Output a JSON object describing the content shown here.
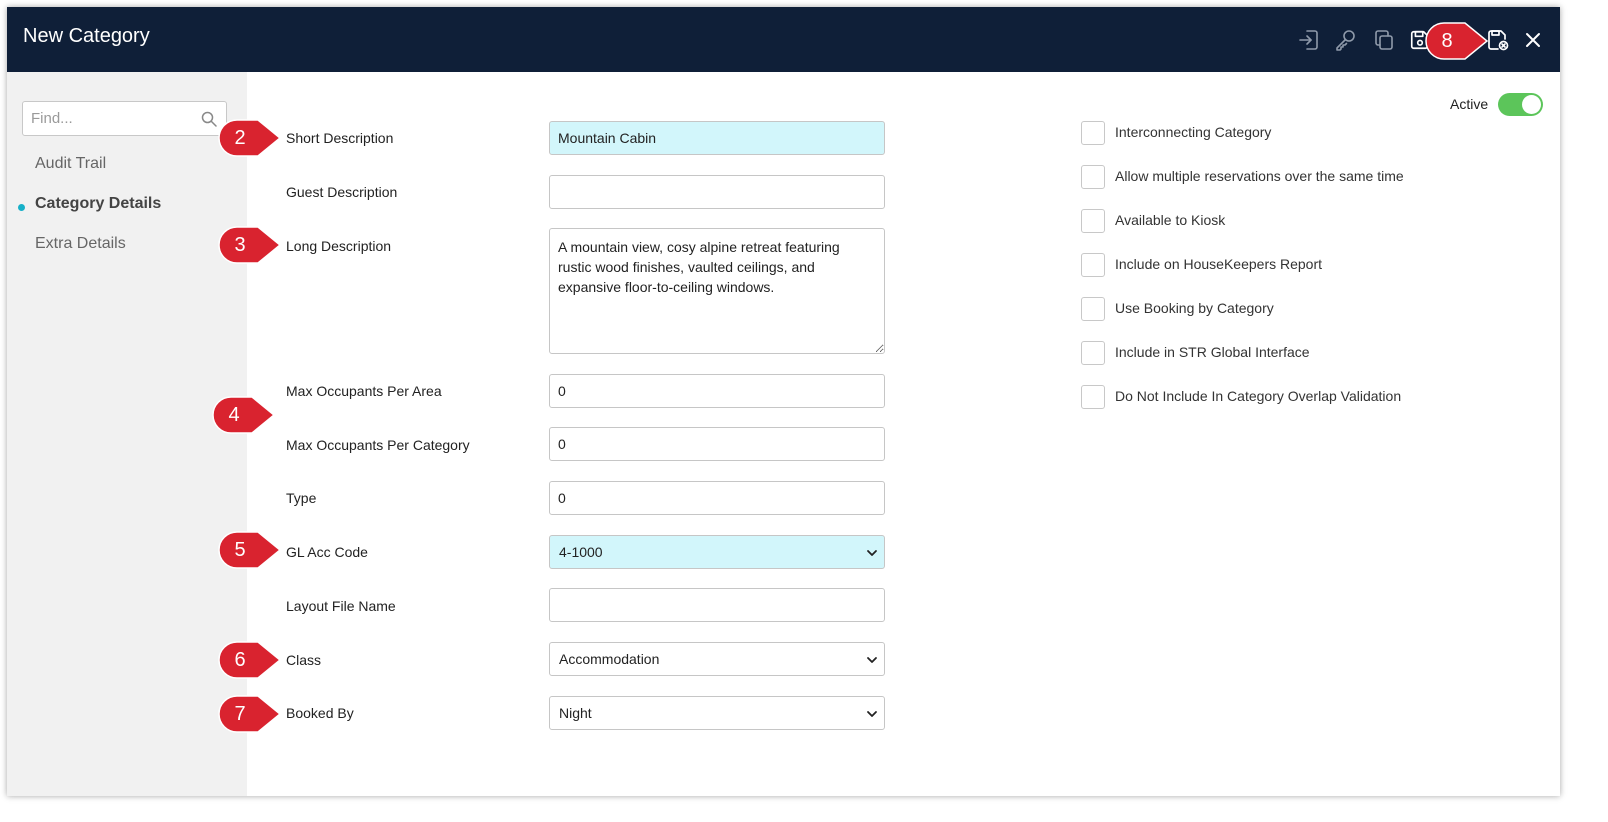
{
  "window": {
    "title": "New Category",
    "toolbar_icons": [
      "sign-in-icon",
      "key-icon",
      "copy-icon",
      "save-icon",
      "save-close-icon",
      "close-icon"
    ]
  },
  "sidebar": {
    "search_placeholder": "Find...",
    "items": [
      {
        "label": "Audit Trail",
        "active": false
      },
      {
        "label": "Category Details",
        "active": true
      },
      {
        "label": "Extra Details",
        "active": false
      }
    ]
  },
  "form": {
    "short_description": {
      "label": "Short Description",
      "value": "Mountain Cabin"
    },
    "guest_description": {
      "label": "Guest Description",
      "value": ""
    },
    "long_description": {
      "label": "Long Description",
      "value": "A mountain view, cosy alpine retreat featuring rustic wood finishes, vaulted ceilings, and expansive floor-to-ceiling windows."
    },
    "max_occ_area": {
      "label": "Max Occupants Per Area",
      "value": "0"
    },
    "max_occ_category": {
      "label": "Max Occupants Per Category",
      "value": "0"
    },
    "type": {
      "label": "Type",
      "value": "0"
    },
    "gl_acc_code": {
      "label": "GL Acc Code",
      "value": "4-1000"
    },
    "layout_file_name": {
      "label": "Layout File Name",
      "value": ""
    },
    "class": {
      "label": "Class",
      "value": "Accommodation"
    },
    "booked_by": {
      "label": "Booked By",
      "value": "Night"
    }
  },
  "active_toggle": {
    "label": "Active",
    "on": true
  },
  "checkboxes": [
    {
      "label": "Interconnecting Category",
      "checked": false
    },
    {
      "label": "Allow multiple reservations over the same time",
      "checked": false
    },
    {
      "label": "Available to Kiosk",
      "checked": false
    },
    {
      "label": "Include on HouseKeepers Report",
      "checked": false
    },
    {
      "label": "Use Booking by Category",
      "checked": false
    },
    {
      "label": "Include in STR Global Interface",
      "checked": false
    },
    {
      "label": "Do Not Include In Category Overlap Validation",
      "checked": false
    }
  ],
  "callouts": [
    "2",
    "3",
    "4",
    "5",
    "6",
    "7",
    "8"
  ],
  "colors": {
    "titlebar": "#0f1f38",
    "highlight_field": "#d2f6fb",
    "active_dot": "#17b0c8",
    "toggle_on": "#5cc55a",
    "callout": "#d9232f"
  }
}
